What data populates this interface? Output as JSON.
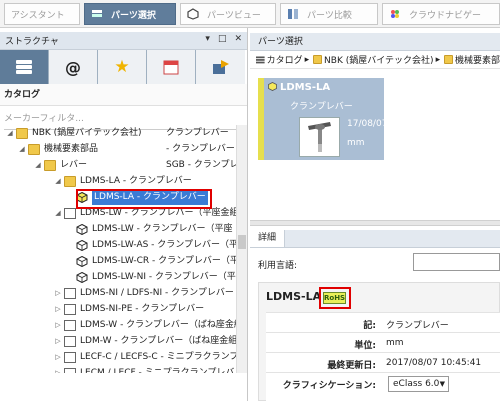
{
  "tabs": [
    {
      "label": "アシスタント",
      "active": false,
      "icon": "none"
    },
    {
      "label": "パーツ選択",
      "active": true,
      "icon": "parts-select-icon"
    },
    {
      "label": "パーツビュー",
      "active": false,
      "icon": "parts-view-icon"
    },
    {
      "label": "パーツ比較",
      "active": false,
      "icon": "parts-compare-icon"
    },
    {
      "label": "クラウドナビゲー",
      "active": false,
      "icon": "cloud-navigator-icon"
    }
  ],
  "left": {
    "title": "ストラクチャ",
    "controls": [
      "▾",
      "□",
      "✕"
    ],
    "icon_buttons": [
      "catalog-icon",
      "at-sign-icon",
      "star-icon",
      "calendar-icon",
      "export-icon"
    ],
    "catalog_label": "カタログ",
    "filter_placeholder": "メーカーフィルタ...",
    "tree": [
      {
        "text": "NBK (鍋屋バイテック会社)",
        "col2": "クランプレバー",
        "level": 0,
        "icon": "folder",
        "toggle": "◢"
      },
      {
        "text": "機械要素部品",
        "col2": "- クランプレバー",
        "level": 1,
        "icon": "folder",
        "toggle": "◢"
      },
      {
        "text": "レバー",
        "col2": "SGB - クランプレ",
        "level": 2,
        "icon": "folder",
        "toggle": "◢"
      },
      {
        "text": "LDMS-LA - クランプレバー",
        "col2": "",
        "level": 3,
        "icon": "folder",
        "toggle": "◢"
      },
      {
        "text": "LDMS-LA - クランプレバー",
        "col2": "",
        "level": 4,
        "icon": "part-selected",
        "toggle": "",
        "selected": true
      },
      {
        "text": "LDMS-LW - クランプレバー（平座金組",
        "col2": "",
        "level": 3,
        "icon": "doc",
        "toggle": "◢"
      },
      {
        "text": "LDMS-LW - クランプレバー（平座",
        "col2": "",
        "level": 4,
        "icon": "cube",
        "toggle": ""
      },
      {
        "text": "LDMS-LW-AS - クランプレバー（平",
        "col2": "",
        "level": 4,
        "icon": "cube",
        "toggle": ""
      },
      {
        "text": "LDMS-LW-CR - クランプレバー（平",
        "col2": "",
        "level": 4,
        "icon": "cube",
        "toggle": ""
      },
      {
        "text": "LDMS-LW-NI - クランプレバー（平",
        "col2": "",
        "level": 4,
        "icon": "cube",
        "toggle": ""
      },
      {
        "text": "LDMS-NI / LDFS-NI - クランプレバー",
        "col2": "",
        "level": 3,
        "icon": "doc",
        "toggle": "▷"
      },
      {
        "text": "LDMS-NI-PE - クランプレバー",
        "col2": "",
        "level": 3,
        "icon": "doc",
        "toggle": "▷"
      },
      {
        "text": "LDMS-W - クランプレバー（ばね座金組",
        "col2": "",
        "level": 3,
        "icon": "doc",
        "toggle": "▷"
      },
      {
        "text": "LDM-W - クランプレバー（ばね座金組",
        "col2": "",
        "level": 3,
        "icon": "doc",
        "toggle": "▷"
      },
      {
        "text": "LECF-C / LECFS-C - ミニプラクランプ",
        "col2": "",
        "level": 3,
        "icon": "doc",
        "toggle": "▷"
      },
      {
        "text": "LECM / LECF - ミニプラクランプレバ",
        "col2": "",
        "level": 3,
        "icon": "doc",
        "toggle": "▷"
      },
      {
        "text": "LECM-C / LECMS-C - ミニプラクランプ",
        "col2": "",
        "level": 3,
        "icon": "doc",
        "toggle": "▷"
      }
    ]
  },
  "parts_select": {
    "title": "パーツ選択",
    "breadcrumb": [
      "カタログ",
      "NBK (鍋屋バイテック会社)",
      "機械要素部"
    ],
    "card": {
      "title": "LDMS-LA",
      "subtitle": "クランプレバー",
      "date": "17/08/07",
      "unit": "mm"
    }
  },
  "detail": {
    "tab": "詳細",
    "language_label": "利用言語:",
    "title": "LDMS-LA",
    "rohs": "RoHS",
    "rows": [
      {
        "key": "記:",
        "value": "クランプレバー"
      },
      {
        "key": "単位:",
        "value": "mm"
      },
      {
        "key": "最終更新日:",
        "value": "2017/08/07 10:45:41"
      },
      {
        "key": "クラフィシケーション:",
        "value": ""
      }
    ],
    "classification_select": "eClass 6.0"
  },
  "colors": {
    "accent": "#607d9b",
    "selection": "#3a7bd5",
    "highlight": "#e00000",
    "card": "#aabed4"
  }
}
